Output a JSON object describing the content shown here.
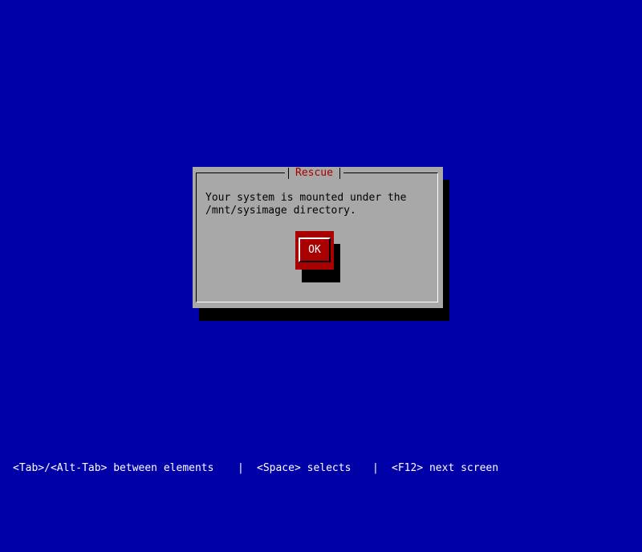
{
  "dialog": {
    "title": "Rescue",
    "message_line_1": "Your system is mounted under the",
    "message_line_2": "/mnt/sysimage directory.",
    "ok_label": "OK"
  },
  "status_bar": {
    "hint_tab": "<Tab>/<Alt-Tab> between elements",
    "separator_1": "|",
    "hint_space": "<Space> selects",
    "separator_2": "|",
    "hint_f12": "<F12> next screen"
  },
  "colors": {
    "background": "#0000a8",
    "dialog": "#a8a8a8",
    "title": "#a80000",
    "button": "#a80000",
    "shadow": "#000000",
    "status_text": "#ffffff"
  }
}
